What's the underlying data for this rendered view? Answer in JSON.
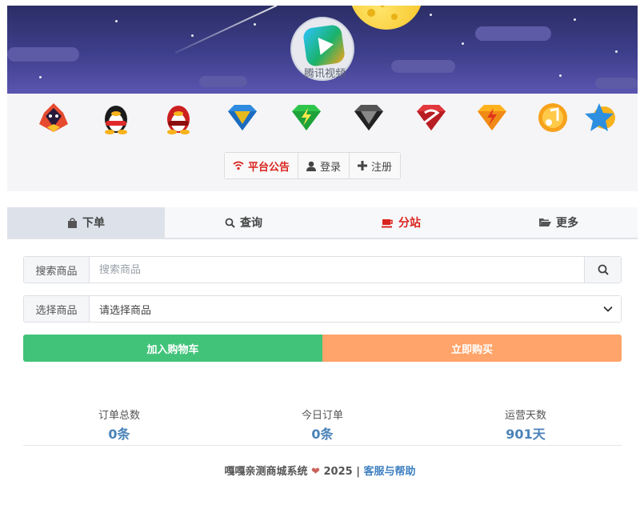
{
  "banner": {
    "logo_text": "腾讯视频"
  },
  "vip_icons": [
    "qzone-vip-icon",
    "qq-penguin-icon",
    "red-penguin-icon",
    "blue-diamond-icon",
    "green-diamond-icon",
    "black-diamond-icon",
    "red-diamond-icon",
    "yellow-diamond-icon",
    "music-icon",
    "star-icon"
  ],
  "notice_bar": {
    "notice_label": "平台公告",
    "login_label": "登录",
    "register_label": "注册"
  },
  "tabs": [
    {
      "label": "下单",
      "icon": "shopping-bag-icon"
    },
    {
      "label": "查询",
      "icon": "search-icon"
    },
    {
      "label": "分站",
      "icon": "coffee-icon"
    },
    {
      "label": "更多",
      "icon": "folder-open-icon"
    }
  ],
  "form": {
    "search_addon": "搜索商品",
    "search_placeholder": "搜索商品",
    "select_addon": "选择商品",
    "select_value": "请选择商品"
  },
  "actions": {
    "cart_label": "加入购物车",
    "buy_label": "立即购买"
  },
  "stats": [
    {
      "label": "订单总数",
      "value": "0条"
    },
    {
      "label": "今日订单",
      "value": "0条"
    },
    {
      "label": "运营天数",
      "value": "901天"
    }
  ],
  "footer": {
    "prefix": "嘎嘎亲测商城系统",
    "year": "2025",
    "separator": "|",
    "link": "客服与帮助"
  },
  "colors": {
    "accent_red": "#d9231d",
    "cart_green": "#42c37a",
    "buy_orange": "#ffa46a",
    "stat_blue": "#4a82b8",
    "link_blue": "#3d7fc1"
  }
}
